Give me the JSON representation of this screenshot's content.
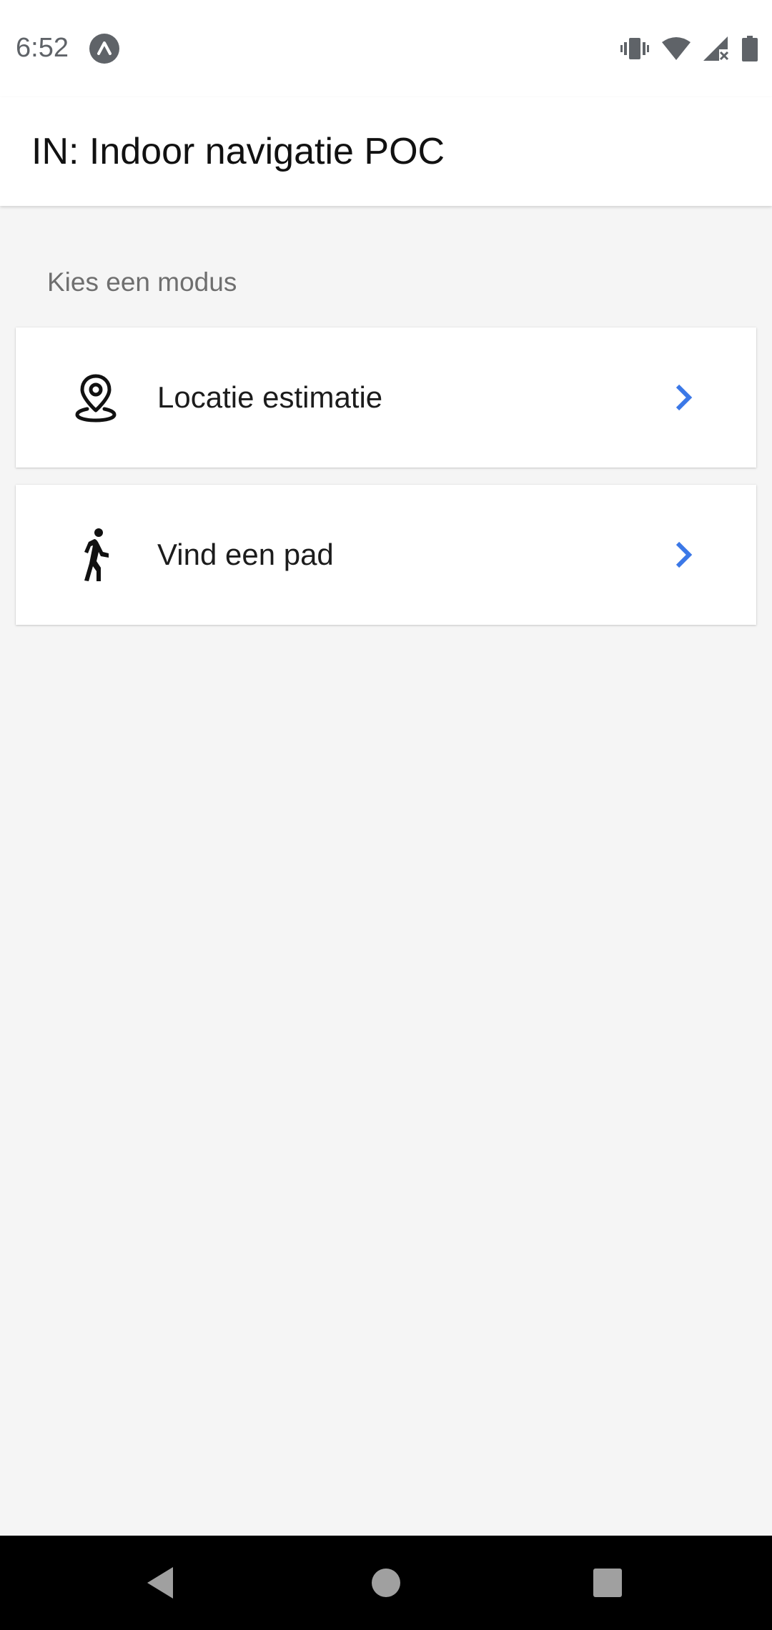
{
  "status_bar": {
    "time": "6:52",
    "icons": [
      "app-notification-icon",
      "vibrate-icon",
      "wifi-icon",
      "cell-signal-no-data-icon",
      "battery-icon"
    ]
  },
  "app_bar": {
    "title": "IN: Indoor navigatie POC"
  },
  "content": {
    "section_label": "Kies een modus",
    "modes": [
      {
        "label": "Locatie estimatie",
        "icon": "location-pin-icon"
      },
      {
        "label": "Vind een pad",
        "icon": "walking-person-icon"
      }
    ]
  },
  "nav_bar": {
    "buttons": [
      "back-icon",
      "home-icon",
      "recents-icon"
    ]
  },
  "colors": {
    "accent": "#3b78e7",
    "background": "#f5f5f5",
    "surface": "#ffffff",
    "nav_bar": "#000000"
  }
}
